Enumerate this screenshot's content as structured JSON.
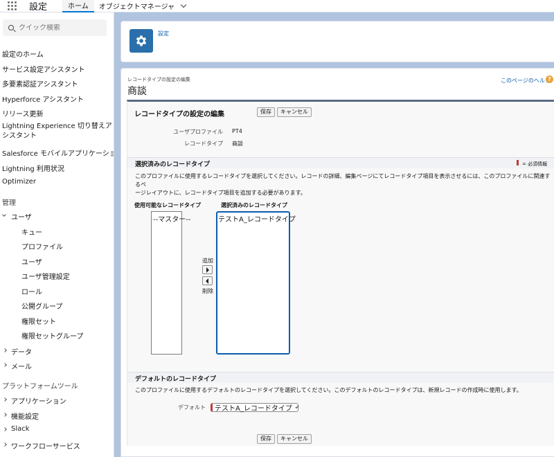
{
  "topbar": {
    "app_name": "設定",
    "tab_home": "ホーム",
    "tab_object_manager": "オブジェクトマネージャ"
  },
  "sidebar": {
    "search_placeholder": "クイック検索",
    "items": [
      "設定のホーム",
      "サービス設定アシスタント",
      "多要素認証アシスタント",
      "Hyperforce アシスタント",
      "リリース更新",
      "Lightning Experience 切り替えアシスタント",
      "Salesforce モバイルアプリケーション",
      "Lightning 利用状況",
      "Optimizer"
    ],
    "admin_heading": "管理",
    "users_group": "ユーザ",
    "users_children": [
      "キュー",
      "プロファイル",
      "ユーザ",
      "ユーザ管理設定",
      "ロール",
      "公開グループ",
      "権限セット",
      "権限セットグループ"
    ],
    "data_group": "データ",
    "email_group": "メール",
    "platform_heading": "プラットフォームツール",
    "platform_items": [
      "アプリケーション",
      "機能設定",
      "Slack",
      "ワークフローサービス"
    ]
  },
  "header": {
    "breadcrumb": "設定"
  },
  "main": {
    "breadcrumb": "レコードタイプの設定の編集",
    "title": "商談",
    "help_link": "このページのヘルプ",
    "help_icon": "?"
  },
  "form": {
    "title": "レコードタイプの設定の編集",
    "save_label": "保存",
    "cancel_label": "キャンセル",
    "user_profile_label": "ユーザプロファイル",
    "user_profile_value": "PT4",
    "record_type_label": "レコードタイプ",
    "record_type_value": "商談",
    "selected_section": {
      "title": "選択済みのレコードタイプ",
      "required_legend": "= 必須情報",
      "description_line1": "このプロファイルに使用するレコードタイプを選択してください。レコードの詳細、編集ページにてレコードタイプ項目を表示させるには、このプロファイルに関連するペ",
      "description_line2": "ージレイアウトに、レコードタイプ項目を追加する必要があります。",
      "available_label": "使用可能なレコードタイプ",
      "selected_label": "選択済みのレコードタイプ",
      "available_options": [
        "--マスター--"
      ],
      "selected_options": [
        "テストA_レコードタイプ"
      ],
      "add_label": "追加",
      "remove_label": "削除"
    },
    "default_section": {
      "title": "デフォルトのレコードタイプ",
      "description": "このプロファイルに使用するデフォルトのレコードタイプを選択してください。このデフォルトのレコードタイプは、新規レコードの作成時に使用します。",
      "default_label": "デフォルト",
      "default_value": "テストA_レコードタイプ"
    }
  },
  "colors": {
    "brand_blue": "#0176d3",
    "gear_tile": "#2a6fab",
    "required_red": "#c23934",
    "background": "#b0c4df"
  }
}
